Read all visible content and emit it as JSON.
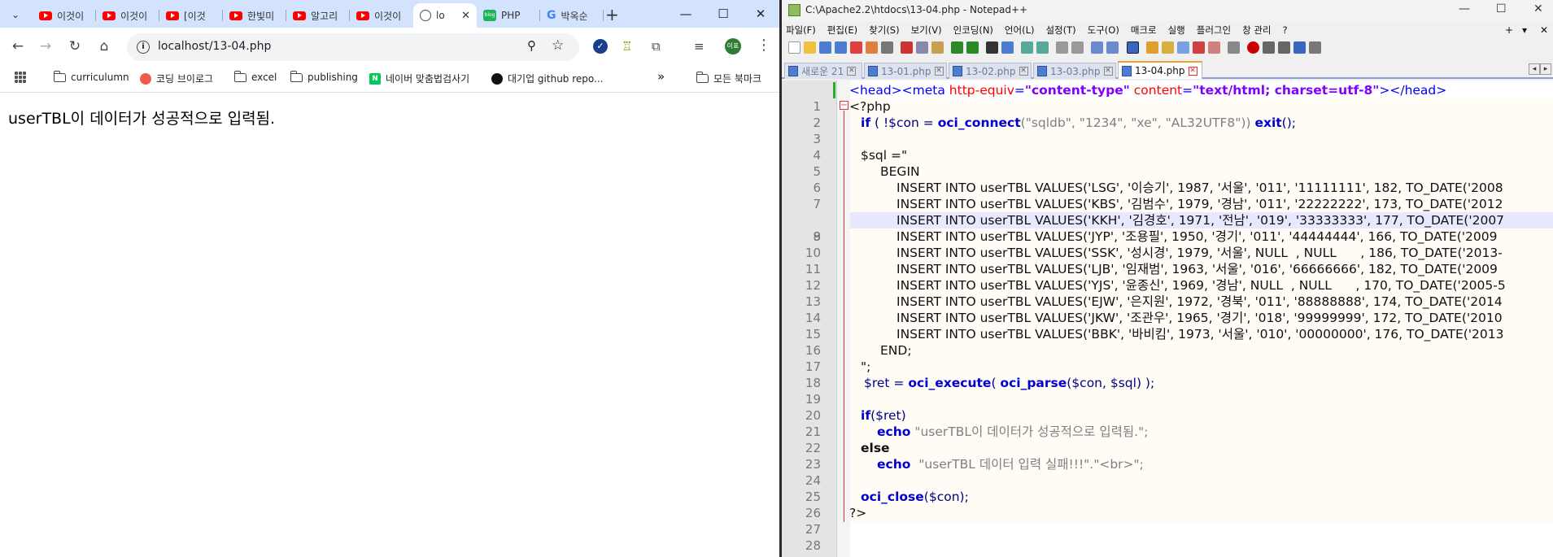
{
  "chrome": {
    "tabs": [
      {
        "icon": "youtube-icon",
        "label": "이것이"
      },
      {
        "icon": "youtube-icon",
        "label": "이것이"
      },
      {
        "icon": "youtube-icon",
        "label": "[이것"
      },
      {
        "icon": "youtube-icon",
        "label": "한빛미"
      },
      {
        "icon": "youtube-icon",
        "label": "알고리"
      },
      {
        "icon": "youtube-icon",
        "label": "이것이"
      },
      {
        "icon": "globe-icon",
        "label": "lo",
        "active": true
      },
      {
        "icon": "blog-icon",
        "label": "PHP"
      },
      {
        "icon": "google-icon",
        "label": "박옥순"
      }
    ],
    "address": "localhost/13-04.php",
    "profile_initials": "이표",
    "bookmarks": [
      {
        "icon": "folder-icon",
        "label": "curriculumn"
      },
      {
        "icon": "blog-dot-icon",
        "label": "코딩 브이로그"
      },
      {
        "icon": "folder-icon",
        "label": "excel"
      },
      {
        "icon": "folder-icon",
        "label": "publishing"
      },
      {
        "icon": "naver-icon",
        "label": "네이버 맞춤법검사기"
      },
      {
        "icon": "github-icon",
        "label": "대기업 github repo..."
      }
    ],
    "bookmarks_more": "»",
    "all_bookmarks": "모든 북마크",
    "page_text": "userTBL이 데이터가 성공적으로 입력됨."
  },
  "npp": {
    "title": "C:\\Apache2.2\\htdocs\\13-04.php - Notepad++",
    "menu": [
      "파일(F)",
      "편집(E)",
      "찾기(S)",
      "보기(V)",
      "인코딩(N)",
      "언어(L)",
      "설정(T)",
      "도구(O)",
      "매크로",
      "실행",
      "플러그인",
      "창 관리",
      "?"
    ],
    "file_tabs": [
      {
        "label": "새로운 21"
      },
      {
        "label": "13-01.php"
      },
      {
        "label": "13-02.php"
      },
      {
        "label": "13-03.php"
      },
      {
        "label": "13-04.php",
        "active": true
      }
    ],
    "line_numbers": [
      "1",
      "2",
      "3",
      "4",
      "5",
      "6",
      "7",
      "8",
      "9",
      "10",
      "11",
      "12",
      "13",
      "14",
      "15",
      "16",
      "17",
      "18",
      "19",
      "20",
      "21",
      "22",
      "23",
      "24",
      "25",
      "26",
      "27",
      "28"
    ],
    "code": {
      "l1_head_open": "<head>",
      "l1_meta_open": "<meta ",
      "l1_attr1": "http-equiv",
      "l1_eq": "=",
      "l1_val1": "\"content-type\"",
      "l1_attr2": "content",
      "l1_val2": "\"text/html; charset=utf-8\"",
      "l1_close": "></head>",
      "l2": "<?php",
      "l3_if": "if",
      "l3_mid": " ( !$con = ",
      "l3_fn": "oci_connect",
      "l3_args": "(\"sqldb\", \"1234\", \"xe\", \"AL32UTF8\")) ",
      "l3_exit": "exit",
      "l3_end": "();",
      "l5": "$sql =\"",
      "l6": "BEGIN",
      "l7": "INSERT INTO userTBL VALUES('LSG', '이승기', 1987, '서울', '011', '11111111', 182, TO_DATE('2008",
      "l8": "INSERT INTO userTBL VALUES('KBS', '김범수', 1979, '경남', '011', '22222222', 173, TO_DATE('2012",
      "l9": "INSERT INTO userTBL VALUES('KKH', '김경호', 1971, '전남', '019', '33333333', 177, TO_DATE('2007",
      "l10": "INSERT INTO userTBL VALUES('JYP', '조용필', 1950, '경기', '011', '44444444', 166, TO_DATE('2009",
      "l11": "INSERT INTO userTBL VALUES('SSK', '성시경', 1979, '서울', NULL  , NULL      , 186, TO_DATE('2013-",
      "l12": "INSERT INTO userTBL VALUES('LJB', '임재범', 1963, '서울', '016', '66666666', 182, TO_DATE('2009",
      "l13": "INSERT INTO userTBL VALUES('YJS', '윤종신', 1969, '경남', NULL  , NULL      , 170, TO_DATE('2005-5",
      "l14": "INSERT INTO userTBL VALUES('EJW', '은지원', 1972, '경북', '011', '88888888', 174, TO_DATE('2014",
      "l15": "INSERT INTO userTBL VALUES('JKW', '조관우', 1965, '경기', '018', '99999999', 172, TO_DATE('2010",
      "l16": "INSERT INTO userTBL VALUES('BBK', '바비킴', 1973, '서울', '010', '00000000', 176, TO_DATE('2013",
      "l17": "END;",
      "l18": "\";",
      "l19_a": "$ret = ",
      "l19_fn1": "oci_execute",
      "l19_b": "( ",
      "l19_fn2": "oci_parse",
      "l19_c": "($con, $sql) );",
      "l21_if": "if",
      "l21_rest": "($ret)",
      "l22_echo": "echo",
      "l22_str": " \"userTBL이 데이터가 성공적으로 입력됨.\";",
      "l23": "else",
      "l24_echo": "echo",
      "l24_str": "  \"userTBL 데이터 입력 실패!!!\".\"<br>\";",
      "l26_fn": "oci_close",
      "l26_rest": "($con);",
      "l27": "?>"
    }
  }
}
